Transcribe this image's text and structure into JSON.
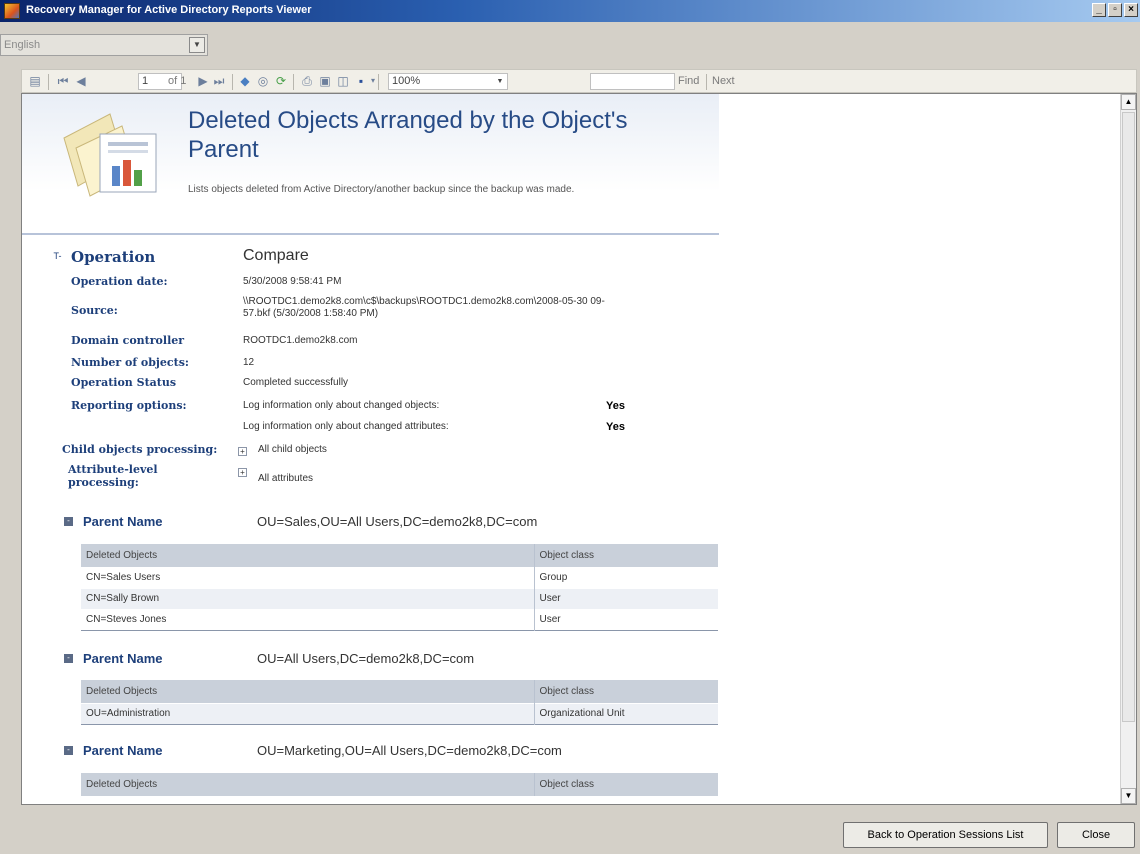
{
  "window": {
    "title": "Recovery Manager for Active Directory Reports Viewer"
  },
  "language": {
    "value": "English"
  },
  "toolbar": {
    "page_current": "1",
    "page_of": "of 1",
    "zoom": "100%",
    "find_label": "Find",
    "next_label": "Next"
  },
  "report": {
    "title": "Deleted Objects Arranged by the Object's Parent",
    "subtitle": "Lists objects deleted from Active Directory/another backup since the backup was made.",
    "operation": {
      "label": "Operation",
      "value": "Compare",
      "date_label": "Operation date:",
      "date_value": "5/30/2008 9:58:41 PM",
      "source_label": "Source:",
      "source_value_line1": "\\\\ROOTDC1.demo2k8.com\\c$\\backups\\ROOTDC1.demo2k8.com\\2008-05-30 09-",
      "source_value_line2": "57.bkf (5/30/2008 1:58:40 PM)",
      "dc_label": "Domain controller",
      "dc_value": "ROOTDC1.demo2k8.com",
      "count_label": "Number of objects:",
      "count_value": "12",
      "status_label": "Operation Status",
      "status_value": "Completed successfully",
      "reporting_label": "Reporting options:",
      "reporting_opt1": "Log information only about changed objects:",
      "reporting_opt1_val": "Yes",
      "reporting_opt2": "Log information only about changed attributes:",
      "reporting_opt2_val": "Yes",
      "child_label": "Child objects processing:",
      "child_value": "All child objects",
      "attr_label_line1": "Attribute-level",
      "attr_label_line2": "processing:",
      "attr_value": "All attributes"
    },
    "groups": [
      {
        "label": "Parent Name",
        "value": "OU=Sales,OU=All Users,DC=demo2k8,DC=com",
        "col1": "Deleted Objects",
        "col2": "Object class",
        "rows": [
          {
            "name": "CN=Sales Users",
            "cls": "Group"
          },
          {
            "name": "CN=Sally Brown",
            "cls": "User"
          },
          {
            "name": "CN=Steves Jones",
            "cls": "User"
          }
        ]
      },
      {
        "label": "Parent Name",
        "value": "OU=All Users,DC=demo2k8,DC=com",
        "col1": "Deleted Objects",
        "col2": "Object class",
        "rows": [
          {
            "name": "OU=Administration",
            "cls": "Organizational Unit"
          }
        ]
      },
      {
        "label": "Parent Name",
        "value": "OU=Marketing,OU=All Users,DC=demo2k8,DC=com",
        "col1": "Deleted Objects",
        "col2": "Object class",
        "rows": []
      }
    ]
  },
  "buttons": {
    "back": "Back to Operation Sessions List",
    "close": "Close"
  }
}
